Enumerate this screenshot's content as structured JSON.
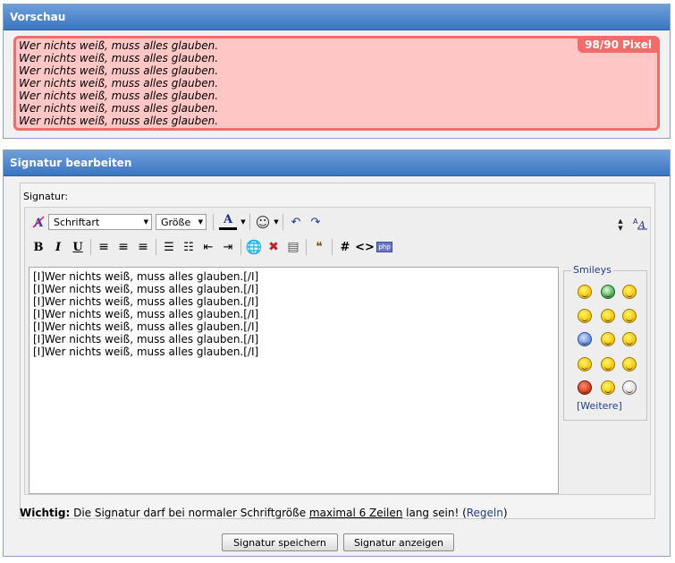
{
  "preview": {
    "title": "Vorschau",
    "badge": "98/90 Pixel",
    "lines": [
      "Wer nichts weiß, muss alles glauben.",
      "Wer nichts weiß, muss alles glauben.",
      "Wer nichts weiß, muss alles glauben.",
      "Wer nichts weiß, muss alles glauben.",
      "Wer nichts weiß, muss alles glauben.",
      "Wer nichts weiß, muss alles glauben.",
      "Wer nichts weiß, muss alles glauben."
    ],
    "colors": {
      "background": "#ffc6c6",
      "border": "#f26c6c"
    }
  },
  "editor": {
    "title": "Signatur bearbeiten",
    "field_label": "Signatur:",
    "font_select": "Schriftart",
    "size_select": "Größe",
    "textarea_lines": [
      "[I]Wer nichts weiß, muss alles glauben.[/I]",
      "[I]Wer nichts weiß, muss alles glauben.[/I]",
      "[I]Wer nichts weiß, muss alles glauben.[/I]",
      "[I]Wer nichts weiß, muss alles glauben.[/I]",
      "[I]Wer nichts weiß, muss alles glauben.[/I]",
      "[I]Wer nichts weiß, muss alles glauben.[/I]",
      "[I]Wer nichts weiß, muss alles glauben.[/I]"
    ],
    "toolbar1": [
      "remove-format-icon",
      "font-color-icon",
      "smiley-menu-icon",
      "undo-icon",
      "redo-icon",
      "resize-icon",
      "switch-editor-icon"
    ],
    "toolbar2": [
      "bold-icon",
      "italic-icon",
      "underline-icon",
      "align-left-icon",
      "align-center-icon",
      "align-right-icon",
      "ordered-list-icon",
      "unordered-list-icon",
      "outdent-icon",
      "indent-icon",
      "insert-link-icon",
      "remove-link-icon",
      "insert-image-icon",
      "quote-icon",
      "hash-icon",
      "code-icon",
      "php-icon"
    ],
    "bold_glyph": "B",
    "italic_glyph": "I",
    "underline_glyph": "U",
    "font_color_glyph": "A",
    "hash_glyph": "#",
    "code_glyph": "<>",
    "smileys_legend": "Smileys",
    "smileys_more_open": "[",
    "smileys_more": "Weitere",
    "smileys_more_close": "]"
  },
  "note": {
    "strong": "Wichtig:",
    "text1": "Die Signatur darf bei normaler Schriftgröße",
    "underlined": "maximal 6 Zeilen",
    "text2": "lang sein! (",
    "link": "Regeln",
    "text3": ")"
  },
  "buttons": {
    "save": "Signatur speichern",
    "show": "Signatur anzeigen"
  },
  "colors": {
    "header": "#3a76c2",
    "link": "#1f3f8f"
  }
}
